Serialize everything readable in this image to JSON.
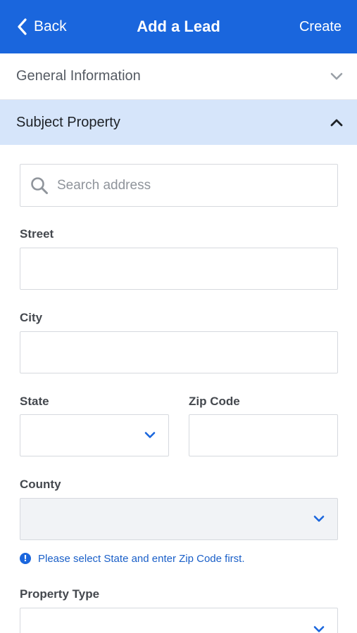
{
  "header": {
    "back_label": "Back",
    "title": "Add a Lead",
    "create_label": "Create",
    "background": "#1a66dd"
  },
  "sections": {
    "general": {
      "title": "General Information",
      "expanded": false,
      "icon": "chevron-down-icon"
    },
    "subject": {
      "title": "Subject Property",
      "expanded": true,
      "icon": "chevron-up-icon",
      "background": "#d6e5fa"
    }
  },
  "search": {
    "placeholder": "Search address",
    "value": "",
    "icon": "search-icon"
  },
  "fields": {
    "street": {
      "label": "Street",
      "value": ""
    },
    "city": {
      "label": "City",
      "value": ""
    },
    "state": {
      "label": "State",
      "value": ""
    },
    "zip": {
      "label": "Zip Code",
      "value": ""
    },
    "county": {
      "label": "County",
      "value": "",
      "disabled": true
    },
    "property_type": {
      "label": "Property Type",
      "value": ""
    }
  },
  "hint": {
    "text": "Please select State and enter Zip Code first.",
    "icon": "info-icon",
    "color": "#1a66dd"
  }
}
